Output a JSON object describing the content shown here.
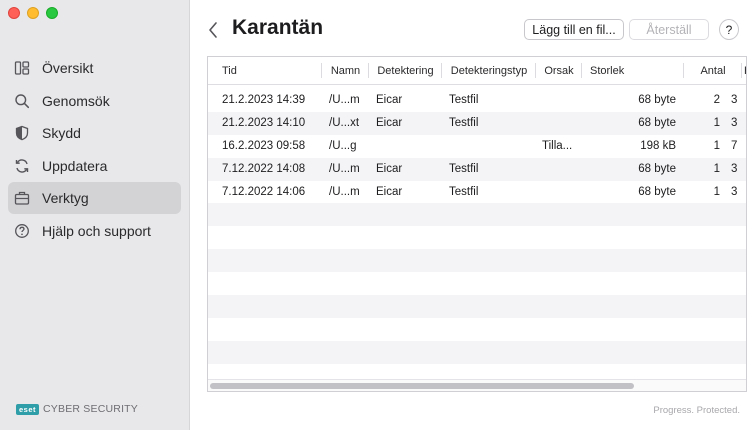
{
  "sidebar": {
    "items": [
      {
        "label": "Översikt",
        "icon": "overview-icon"
      },
      {
        "label": "Genomsök",
        "icon": "search-icon"
      },
      {
        "label": "Skydd",
        "icon": "shield-icon"
      },
      {
        "label": "Uppdatera",
        "icon": "refresh-icon"
      },
      {
        "label": "Verktyg",
        "icon": "briefcase-icon",
        "active": true
      },
      {
        "label": "Hjälp och support",
        "icon": "help-icon"
      }
    ],
    "brand_logo": "eset",
    "brand_text": "CYBER SECURITY"
  },
  "header": {
    "title": "Karantän",
    "add_file_label": "Lägg till en fil...",
    "restore_label": "Återställ",
    "help_label": "?"
  },
  "table": {
    "columns": [
      "Tid",
      "Namn",
      "Detektering",
      "Detekteringstyp",
      "Orsak",
      "Storlek",
      "Antal",
      "H"
    ],
    "rows": [
      [
        "21.2.2023 14:39",
        "/U...m",
        "Eicar",
        "Testfil",
        "",
        "68 byte",
        "2",
        "3"
      ],
      [
        "21.2.2023 14:10",
        "/U...xt",
        "Eicar",
        "Testfil",
        "",
        "68 byte",
        "1",
        "3"
      ],
      [
        "16.2.2023 09:58",
        "/U...g",
        "",
        "",
        "Tilla...",
        "198 kB",
        "1",
        "7"
      ],
      [
        "7.12.2022 14:08",
        "/U...m",
        "Eicar",
        "Testfil",
        "",
        "68 byte",
        "1",
        "3"
      ],
      [
        "7.12.2022 14:06",
        "/U...m",
        "Eicar",
        "Testfil",
        "",
        "68 byte",
        "1",
        "3"
      ]
    ],
    "empty_rows": 8
  },
  "footer": {
    "tagline": "Progress. Protected."
  },
  "colors": {
    "sidebar_bg": "#e8e8ea",
    "active_item_bg": "#d3d3d6",
    "alt_row_bg": "#f4f4f6",
    "brand_teal": "#2f9ea8"
  }
}
